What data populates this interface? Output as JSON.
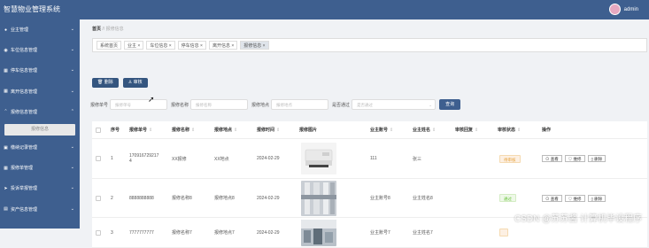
{
  "header": {
    "title": "智慧物业管理系统",
    "username": "admin"
  },
  "sidebar": {
    "items": [
      {
        "label": "业主管理",
        "icon": "user-icon"
      },
      {
        "label": "车位信息管理",
        "icon": "map-pin-icon"
      },
      {
        "label": "停车信息管理",
        "icon": "grid-icon"
      },
      {
        "label": "离开信息管理",
        "icon": "grid-icon"
      },
      {
        "label": "报修信息管理",
        "icon": "chevron-up-icon"
      },
      {
        "label": "缴纳记录管理",
        "icon": "car-icon"
      },
      {
        "label": "报修单管理",
        "icon": "grid-icon"
      },
      {
        "label": "投诉举报管理",
        "icon": "send-icon"
      },
      {
        "label": "资产信息管理",
        "icon": "building-icon"
      }
    ],
    "active_sub": "报修信息"
  },
  "breadcrumb": {
    "home": "首页",
    "sep": "//",
    "current": "报修信息"
  },
  "tabs": [
    "系统首页",
    "业主 ×",
    "车位信息 ×",
    "停车信息 ×",
    "离开信息 ×",
    "报修信息 ×"
  ],
  "toolbar": {
    "delete": "删除",
    "audit": "审核"
  },
  "search": {
    "label1": "报修单号",
    "ph1": "报修单号",
    "label2": "报修名称",
    "ph2": "报修名称",
    "label3": "报修地点",
    "ph3": "报修地点",
    "label4": "是否通过",
    "ph4": "是否通过",
    "button": "查询"
  },
  "table": {
    "headers": [
      "序号",
      "报修单号",
      "报修名称",
      "报修地点",
      "报修时间",
      "报修图片",
      "业主账号",
      "业主姓名",
      "审核回复",
      "审核状态",
      "操作"
    ],
    "rows": [
      {
        "idx": "1",
        "no_line1": "170916729217",
        "no_line2": "4",
        "name": "XX报修",
        "place": "XX地点",
        "time": "2024-02-29",
        "account": "111",
        "owner": "张三",
        "status": "待审核"
      },
      {
        "idx": "2",
        "no_line1": "8888888888",
        "no_line2": "",
        "name": "报修名称8",
        "place": "报修地点8",
        "time": "2024-02-29",
        "account": "业主账号8",
        "owner": "业主姓名8",
        "status": "通过"
      },
      {
        "idx": "3",
        "no_line1": "7777777777",
        "no_line2": "",
        "name": "报修名称7",
        "place": "报修地点7",
        "time": "2024-02-29",
        "account": "业主账号7",
        "owner": "业主姓名7",
        "status": ""
      }
    ],
    "actions": {
      "view": "查看",
      "repair": "维修",
      "delete": "删除"
    }
  },
  "watermark": "CSDN @苏苏酱  计算机毕设程序",
  "colors": {
    "brand": "#3e5f8f",
    "button": "#34557f",
    "pending": "#e6a23c",
    "pass": "#67c23a"
  }
}
